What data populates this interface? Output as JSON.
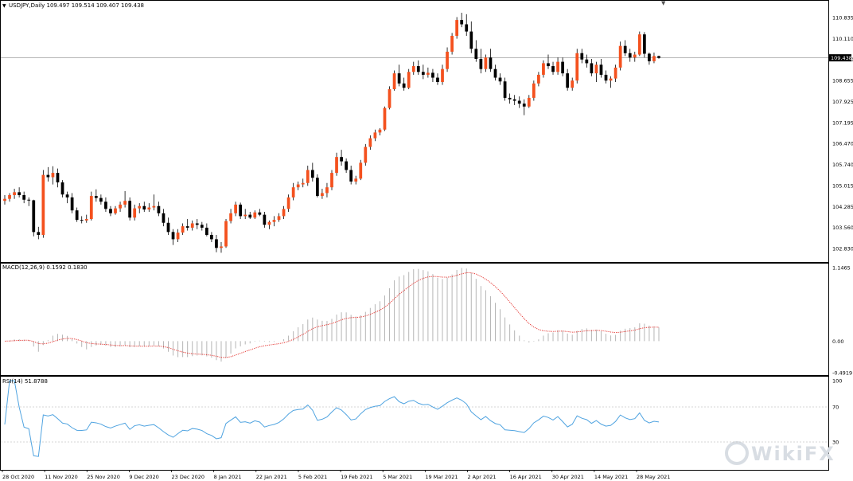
{
  "colors": {
    "bull": "#f4511e",
    "bear": "#000000",
    "grid_frame": "#000000",
    "macd_hist": "#b5b5b5",
    "macd_signal": "#e53935",
    "rsi_line": "#4fa3e0",
    "rsi_levels": "#c8c8c8",
    "price_line": "#9e9e9e",
    "current_price_bg": "#000000",
    "current_price_fg": "#ffffff",
    "watermark": "#d8dde3"
  },
  "header": {
    "symbol_line": "USDJPY,Daily  109.497 109.514 109.407 109.438"
  },
  "watermark": {
    "text": "WikiFX",
    "icon": "wikifx-logo-icon"
  },
  "chart_data": [
    {
      "type": "candlestick",
      "panel": "price",
      "title": "USDJPY,Daily",
      "last_ohlc": {
        "open": 109.497,
        "high": 109.514,
        "low": 109.407,
        "close": 109.438
      },
      "current_price_label": "109.438",
      "current_price": 109.438,
      "yticks": [
        "110.835",
        "110.110",
        "109.380",
        "108.655",
        "107.925",
        "107.195",
        "106.470",
        "105.740",
        "105.015",
        "104.285",
        "103.560",
        "102.830"
      ],
      "ylim": [
        102.5,
        111.5
      ],
      "candles": [
        {
          "o": 104.48,
          "h": 104.68,
          "l": 104.35,
          "c": 104.55
        },
        {
          "o": 104.55,
          "h": 104.75,
          "l": 104.45,
          "c": 104.68
        },
        {
          "o": 104.68,
          "h": 104.9,
          "l": 104.55,
          "c": 104.78
        },
        {
          "o": 104.78,
          "h": 104.95,
          "l": 104.6,
          "c": 104.68
        },
        {
          "o": 104.68,
          "h": 104.8,
          "l": 104.4,
          "c": 104.52
        },
        {
          "o": 104.52,
          "h": 104.6,
          "l": 104.3,
          "c": 104.5
        },
        {
          "o": 104.5,
          "h": 104.52,
          "l": 103.25,
          "c": 103.4
        },
        {
          "o": 103.4,
          "h": 103.58,
          "l": 103.15,
          "c": 103.3
        },
        {
          "o": 103.3,
          "h": 105.55,
          "l": 103.2,
          "c": 105.38
        },
        {
          "o": 105.38,
          "h": 105.65,
          "l": 105.15,
          "c": 105.3
        },
        {
          "o": 105.3,
          "h": 105.68,
          "l": 105.05,
          "c": 105.45
        },
        {
          "o": 105.45,
          "h": 105.6,
          "l": 104.95,
          "c": 105.12
        },
        {
          "o": 105.12,
          "h": 105.2,
          "l": 104.6,
          "c": 104.7
        },
        {
          "o": 104.7,
          "h": 104.8,
          "l": 104.4,
          "c": 104.6
        },
        {
          "o": 104.6,
          "h": 104.75,
          "l": 104.05,
          "c": 104.15
        },
        {
          "o": 104.15,
          "h": 104.25,
          "l": 103.75,
          "c": 103.82
        },
        {
          "o": 103.82,
          "h": 103.95,
          "l": 103.7,
          "c": 103.8
        },
        {
          "o": 103.8,
          "h": 104.0,
          "l": 103.72,
          "c": 103.85
        },
        {
          "o": 103.85,
          "h": 104.8,
          "l": 103.8,
          "c": 104.65
        },
        {
          "o": 104.65,
          "h": 104.88,
          "l": 104.45,
          "c": 104.58
        },
        {
          "o": 104.58,
          "h": 104.7,
          "l": 104.35,
          "c": 104.45
        },
        {
          "o": 104.45,
          "h": 104.6,
          "l": 104.1,
          "c": 104.2
        },
        {
          "o": 104.2,
          "h": 104.3,
          "l": 103.95,
          "c": 104.05
        },
        {
          "o": 104.05,
          "h": 104.3,
          "l": 104.0,
          "c": 104.22
        },
        {
          "o": 104.22,
          "h": 104.45,
          "l": 104.1,
          "c": 104.35
        },
        {
          "o": 104.35,
          "h": 104.82,
          "l": 104.25,
          "c": 104.48
        },
        {
          "o": 104.48,
          "h": 104.6,
          "l": 103.8,
          "c": 103.9
        },
        {
          "o": 103.9,
          "h": 104.35,
          "l": 103.8,
          "c": 104.22
        },
        {
          "o": 104.22,
          "h": 104.4,
          "l": 104.05,
          "c": 104.3
        },
        {
          "o": 104.3,
          "h": 104.45,
          "l": 104.1,
          "c": 104.18
        },
        {
          "o": 104.18,
          "h": 104.4,
          "l": 104.1,
          "c": 104.25
        },
        {
          "o": 104.25,
          "h": 104.7,
          "l": 104.15,
          "c": 104.3
        },
        {
          "o": 104.3,
          "h": 104.45,
          "l": 103.95,
          "c": 104.05
        },
        {
          "o": 104.05,
          "h": 104.2,
          "l": 103.6,
          "c": 103.72
        },
        {
          "o": 103.72,
          "h": 103.9,
          "l": 103.3,
          "c": 103.4
        },
        {
          "o": 103.4,
          "h": 103.5,
          "l": 102.95,
          "c": 103.15
        },
        {
          "o": 103.15,
          "h": 103.5,
          "l": 103.05,
          "c": 103.38
        },
        {
          "o": 103.38,
          "h": 103.7,
          "l": 103.3,
          "c": 103.6
        },
        {
          "o": 103.6,
          "h": 103.85,
          "l": 103.45,
          "c": 103.55
        },
        {
          "o": 103.55,
          "h": 103.8,
          "l": 103.45,
          "c": 103.7
        },
        {
          "o": 103.7,
          "h": 103.85,
          "l": 103.5,
          "c": 103.65
        },
        {
          "o": 103.65,
          "h": 103.75,
          "l": 103.45,
          "c": 103.55
        },
        {
          "o": 103.55,
          "h": 103.7,
          "l": 103.25,
          "c": 103.3
        },
        {
          "o": 103.3,
          "h": 103.4,
          "l": 103.05,
          "c": 103.15
        },
        {
          "o": 103.15,
          "h": 103.3,
          "l": 102.7,
          "c": 102.85
        },
        {
          "o": 102.85,
          "h": 103.05,
          "l": 102.68,
          "c": 102.9
        },
        {
          "o": 102.9,
          "h": 103.85,
          "l": 102.85,
          "c": 103.78
        },
        {
          "o": 103.78,
          "h": 104.2,
          "l": 103.7,
          "c": 104.05
        },
        {
          "o": 104.05,
          "h": 104.45,
          "l": 103.95,
          "c": 104.35
        },
        {
          "o": 104.35,
          "h": 104.42,
          "l": 103.85,
          "c": 103.95
        },
        {
          "o": 103.95,
          "h": 104.2,
          "l": 103.85,
          "c": 104.0
        },
        {
          "o": 104.0,
          "h": 104.1,
          "l": 103.85,
          "c": 103.9
        },
        {
          "o": 103.9,
          "h": 104.15,
          "l": 103.85,
          "c": 104.08
        },
        {
          "o": 104.08,
          "h": 104.2,
          "l": 103.95,
          "c": 104.0
        },
        {
          "o": 104.0,
          "h": 104.1,
          "l": 103.55,
          "c": 103.65
        },
        {
          "o": 103.65,
          "h": 103.8,
          "l": 103.5,
          "c": 103.75
        },
        {
          "o": 103.75,
          "h": 103.95,
          "l": 103.6,
          "c": 103.82
        },
        {
          "o": 103.82,
          "h": 104.05,
          "l": 103.75,
          "c": 103.95
        },
        {
          "o": 103.95,
          "h": 104.3,
          "l": 103.85,
          "c": 104.2
        },
        {
          "o": 104.2,
          "h": 104.7,
          "l": 104.1,
          "c": 104.6
        },
        {
          "o": 104.6,
          "h": 105.1,
          "l": 104.5,
          "c": 104.95
        },
        {
          "o": 104.95,
          "h": 105.15,
          "l": 104.85,
          "c": 105.05
        },
        {
          "o": 105.05,
          "h": 105.25,
          "l": 104.95,
          "c": 105.1
        },
        {
          "o": 105.1,
          "h": 105.7,
          "l": 105.0,
          "c": 105.55
        },
        {
          "o": 105.55,
          "h": 105.8,
          "l": 105.15,
          "c": 105.28
        },
        {
          "o": 105.28,
          "h": 105.4,
          "l": 104.6,
          "c": 104.65
        },
        {
          "o": 104.65,
          "h": 104.9,
          "l": 104.55,
          "c": 104.75
        },
        {
          "o": 104.75,
          "h": 105.1,
          "l": 104.6,
          "c": 104.95
        },
        {
          "o": 104.95,
          "h": 105.55,
          "l": 104.85,
          "c": 105.45
        },
        {
          "o": 105.45,
          "h": 106.15,
          "l": 105.35,
          "c": 106.0
        },
        {
          "o": 106.0,
          "h": 106.25,
          "l": 105.7,
          "c": 105.85
        },
        {
          "o": 105.85,
          "h": 105.95,
          "l": 105.45,
          "c": 105.55
        },
        {
          "o": 105.55,
          "h": 105.7,
          "l": 105.05,
          "c": 105.15
        },
        {
          "o": 105.15,
          "h": 105.35,
          "l": 105.05,
          "c": 105.25
        },
        {
          "o": 105.25,
          "h": 105.9,
          "l": 105.2,
          "c": 105.8
        },
        {
          "o": 105.8,
          "h": 106.45,
          "l": 105.7,
          "c": 106.35
        },
        {
          "o": 106.35,
          "h": 106.75,
          "l": 106.25,
          "c": 106.65
        },
        {
          "o": 106.65,
          "h": 106.95,
          "l": 106.55,
          "c": 106.85
        },
        {
          "o": 106.85,
          "h": 107.0,
          "l": 106.75,
          "c": 106.95
        },
        {
          "o": 106.95,
          "h": 107.75,
          "l": 106.9,
          "c": 107.7
        },
        {
          "o": 107.7,
          "h": 108.45,
          "l": 107.65,
          "c": 108.35
        },
        {
          "o": 108.35,
          "h": 109.0,
          "l": 108.3,
          "c": 108.9
        },
        {
          "o": 108.9,
          "h": 109.2,
          "l": 108.45,
          "c": 108.55
        },
        {
          "o": 108.55,
          "h": 108.75,
          "l": 108.3,
          "c": 108.4
        },
        {
          "o": 108.4,
          "h": 109.05,
          "l": 108.35,
          "c": 108.95
        },
        {
          "o": 108.95,
          "h": 109.3,
          "l": 108.85,
          "c": 109.15
        },
        {
          "o": 109.15,
          "h": 109.35,
          "l": 108.85,
          "c": 108.95
        },
        {
          "o": 108.95,
          "h": 109.2,
          "l": 108.7,
          "c": 108.85
        },
        {
          "o": 108.85,
          "h": 109.1,
          "l": 108.75,
          "c": 108.92
        },
        {
          "o": 108.92,
          "h": 109.05,
          "l": 108.6,
          "c": 108.75
        },
        {
          "o": 108.75,
          "h": 108.9,
          "l": 108.5,
          "c": 108.6
        },
        {
          "o": 108.6,
          "h": 109.2,
          "l": 108.5,
          "c": 109.05
        },
        {
          "o": 109.05,
          "h": 109.8,
          "l": 108.95,
          "c": 109.65
        },
        {
          "o": 109.65,
          "h": 110.3,
          "l": 109.55,
          "c": 110.2
        },
        {
          "o": 110.2,
          "h": 110.85,
          "l": 110.1,
          "c": 110.75
        },
        {
          "o": 110.75,
          "h": 111.0,
          "l": 110.5,
          "c": 110.6
        },
        {
          "o": 110.6,
          "h": 110.95,
          "l": 110.2,
          "c": 110.35
        },
        {
          "o": 110.35,
          "h": 110.7,
          "l": 109.6,
          "c": 109.75
        },
        {
          "o": 109.75,
          "h": 110.05,
          "l": 109.3,
          "c": 109.4
        },
        {
          "o": 109.4,
          "h": 109.75,
          "l": 108.9,
          "c": 109.05
        },
        {
          "o": 109.05,
          "h": 109.55,
          "l": 108.95,
          "c": 109.45
        },
        {
          "o": 109.45,
          "h": 109.75,
          "l": 108.95,
          "c": 109.05
        },
        {
          "o": 109.05,
          "h": 109.2,
          "l": 108.65,
          "c": 108.75
        },
        {
          "o": 108.75,
          "h": 108.9,
          "l": 108.5,
          "c": 108.62
        },
        {
          "o": 108.62,
          "h": 108.75,
          "l": 107.95,
          "c": 108.05
        },
        {
          "o": 108.05,
          "h": 108.2,
          "l": 107.85,
          "c": 108.0
        },
        {
          "o": 108.0,
          "h": 108.15,
          "l": 107.8,
          "c": 107.95
        },
        {
          "o": 107.95,
          "h": 108.1,
          "l": 107.7,
          "c": 107.85
        },
        {
          "o": 107.85,
          "h": 108.0,
          "l": 107.45,
          "c": 107.75
        },
        {
          "o": 107.75,
          "h": 108.15,
          "l": 107.7,
          "c": 108.05
        },
        {
          "o": 108.05,
          "h": 108.65,
          "l": 107.95,
          "c": 108.55
        },
        {
          "o": 108.55,
          "h": 108.95,
          "l": 108.45,
          "c": 108.85
        },
        {
          "o": 108.85,
          "h": 109.35,
          "l": 108.75,
          "c": 109.25
        },
        {
          "o": 109.25,
          "h": 109.55,
          "l": 109.05,
          "c": 109.15
        },
        {
          "o": 109.15,
          "h": 109.3,
          "l": 108.85,
          "c": 108.95
        },
        {
          "o": 108.95,
          "h": 109.45,
          "l": 108.85,
          "c": 109.3
        },
        {
          "o": 109.3,
          "h": 109.45,
          "l": 108.8,
          "c": 108.9
        },
        {
          "o": 108.9,
          "h": 109.05,
          "l": 108.3,
          "c": 108.4
        },
        {
          "o": 108.4,
          "h": 108.75,
          "l": 108.3,
          "c": 108.65
        },
        {
          "o": 108.65,
          "h": 109.75,
          "l": 108.55,
          "c": 109.6
        },
        {
          "o": 109.6,
          "h": 109.75,
          "l": 109.25,
          "c": 109.38
        },
        {
          "o": 109.38,
          "h": 109.55,
          "l": 109.1,
          "c": 109.25
        },
        {
          "o": 109.25,
          "h": 109.4,
          "l": 108.8,
          "c": 108.9
        },
        {
          "o": 108.9,
          "h": 109.3,
          "l": 108.6,
          "c": 109.2
        },
        {
          "o": 109.2,
          "h": 109.4,
          "l": 108.75,
          "c": 108.85
        },
        {
          "o": 108.85,
          "h": 109.0,
          "l": 108.55,
          "c": 108.65
        },
        {
          "o": 108.65,
          "h": 108.8,
          "l": 108.4,
          "c": 108.72
        },
        {
          "o": 108.72,
          "h": 109.2,
          "l": 108.6,
          "c": 109.1
        },
        {
          "o": 109.1,
          "h": 110.0,
          "l": 109.0,
          "c": 109.85
        },
        {
          "o": 109.85,
          "h": 110.05,
          "l": 109.5,
          "c": 109.6
        },
        {
          "o": 109.6,
          "h": 109.75,
          "l": 109.3,
          "c": 109.45
        },
        {
          "o": 109.45,
          "h": 109.65,
          "l": 109.3,
          "c": 109.55
        },
        {
          "o": 109.55,
          "h": 110.35,
          "l": 109.5,
          "c": 110.25
        },
        {
          "o": 110.25,
          "h": 110.33,
          "l": 109.45,
          "c": 109.58
        },
        {
          "o": 109.58,
          "h": 109.62,
          "l": 109.2,
          "c": 109.32
        },
        {
          "o": 109.32,
          "h": 109.62,
          "l": 109.25,
          "c": 109.5
        },
        {
          "o": 109.497,
          "h": 109.514,
          "l": 109.407,
          "c": 109.438
        }
      ]
    },
    {
      "type": "macd",
      "panel": "macd",
      "label": "MACD(12,26,9) 0.1592 0.1830",
      "params": "12,26,9",
      "main": 0.1592,
      "signal_value": 0.183,
      "yticks": [
        "1.1465",
        "0.00",
        "-0.4919"
      ],
      "ylim": [
        -0.4919,
        1.1465
      ]
    },
    {
      "type": "line",
      "panel": "rsi",
      "label": "RSI(14) 51.8788",
      "period": 14,
      "value": 51.8788,
      "yticks": [
        "100",
        "70",
        "30"
      ],
      "levels": [
        70,
        30
      ],
      "ylim": [
        0,
        100
      ]
    }
  ],
  "xaxis": {
    "labels": [
      "28 Oct 2020",
      "11 Nov 2020",
      "25 Nov 2020",
      "9 Dec 2020",
      "23 Dec 2020",
      "8 Jan 2021",
      "22 Jan 2021",
      "5 Feb 2021",
      "19 Feb 2021",
      "5 Mar 2021",
      "19 Mar 2021",
      "2 Apr 2021",
      "16 Apr 2021",
      "30 Apr 2021",
      "14 May 2021",
      "28 May 2021"
    ]
  }
}
